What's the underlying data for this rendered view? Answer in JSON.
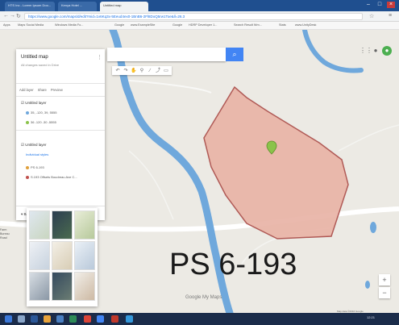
{
  "browser": {
    "tabs": [
      {
        "label": "HTS Inc - Lorem Ipsum Doo..."
      },
      {
        "label": "Kenya Hotel ..."
      },
      {
        "label": "Untitled map"
      }
    ],
    "url": "https://www.google.com/maps/d/edit?mid=1v6Kq3x-5Eeud4ex0-1BnB6-2Fl8DoQ5rw1Toe&ll=26.3",
    "bookmarks": [
      "Apps",
      "Maps Social Media",
      "Windows Media Fo...",
      "Google",
      "www.ExampleSite",
      "Google",
      "HDRP Developer 1...",
      "Search Result Wm...",
      "Stats",
      "www.UnityDesk"
    ]
  },
  "map": {
    "panel": {
      "title": "Untitled map",
      "subtitle": "All changes saved in Drive",
      "actions": [
        "Add layer",
        "Share",
        "Preview"
      ],
      "layer1_head": "Untitled layer",
      "layer1_rows": [
        "35, -120, 39, 5555",
        "36 -120 -30 -5555"
      ],
      "layer2_head": "Untitled layer",
      "layer2_link": "Individual styles",
      "layer2_rows": [
        "PS 6-193",
        "S.193 Offsets Boudreau Ave C..."
      ],
      "basemap_label": "Base map"
    },
    "label": "PS 6-193",
    "logo": "Google My Maps",
    "attribution": "Map data ©2016 Google",
    "zoom_in": "+",
    "zoom_out": "−",
    "left_edge_text": [
      "Farm",
      "Bureau",
      "Road"
    ]
  },
  "taskbar": {
    "time": "12:21"
  },
  "colors": {
    "polygon_fill": "#e8b3a6",
    "polygon_stroke": "#b05a56",
    "river": "#6fa8dc",
    "accent": "#4285f4"
  }
}
